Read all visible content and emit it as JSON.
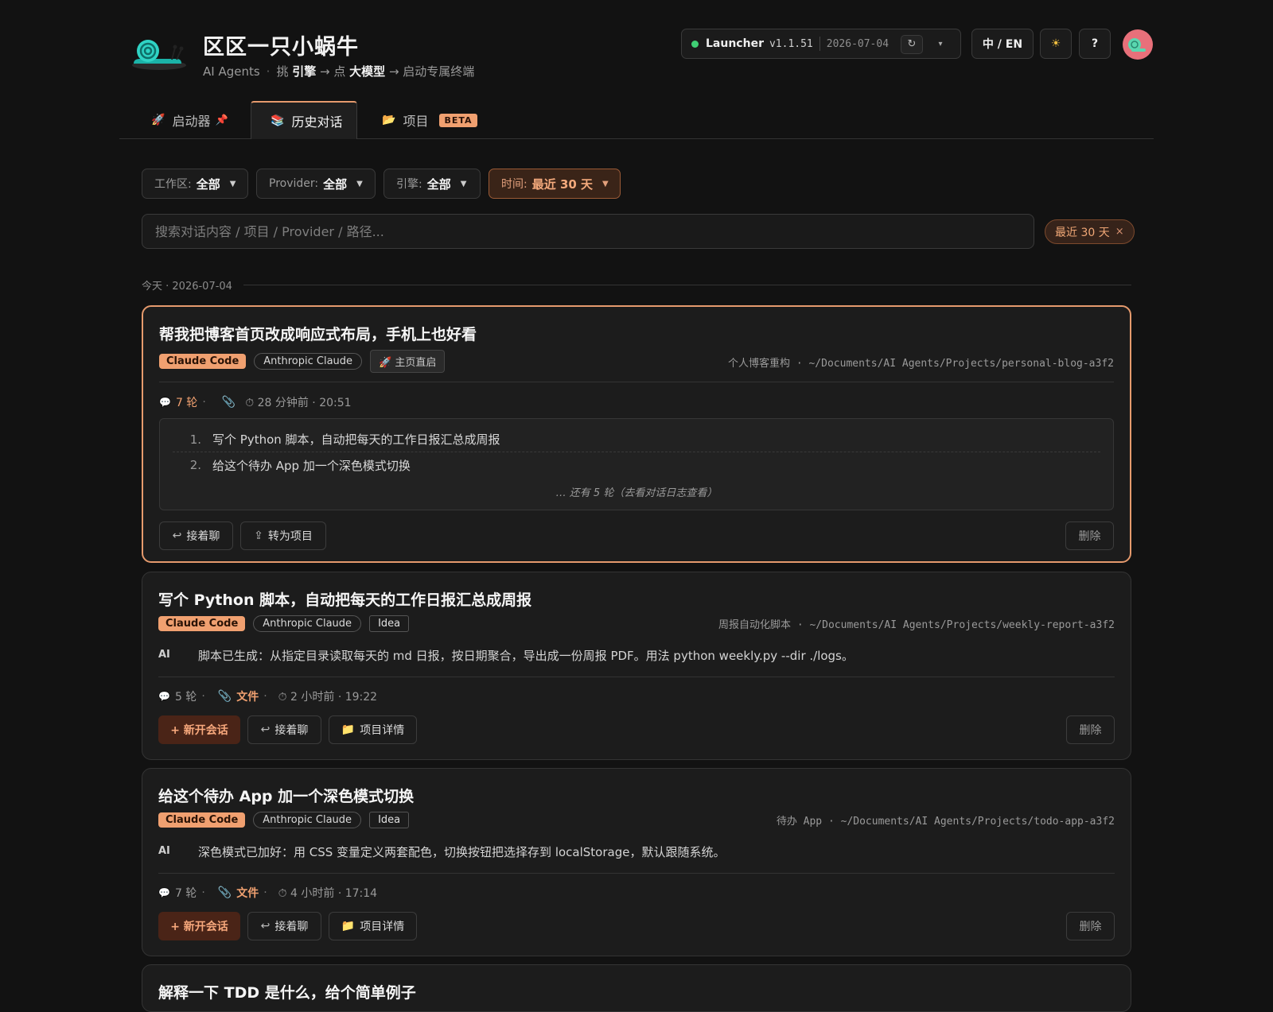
{
  "brand": {
    "title": "区区一只小蜗牛",
    "sub_prefix": "AI Agents",
    "sub_sep": "·",
    "sub_pick": "挑",
    "sub_engine": "引擎",
    "sub_arrow1": "→ 点",
    "sub_model": "大模型",
    "sub_arrow2": "→ 启动专属终端"
  },
  "launcher": {
    "name": "Launcher",
    "version": "v1.1.51",
    "date": "2026-07-04",
    "refresh_icon": "↻",
    "caret_icon": "▾",
    "status_color": "#3fcf74"
  },
  "header_buttons": {
    "lang": "中 / EN",
    "theme_icon": "☀",
    "help": "?"
  },
  "tabs": [
    {
      "icon": "🚀",
      "label": "启动器",
      "pin": "📌"
    },
    {
      "icon": "📚",
      "label": "历史对话"
    },
    {
      "icon": "📂",
      "label": "项目",
      "badge": "BETA"
    }
  ],
  "filters": {
    "workspace": {
      "label": "工作区:",
      "value": "全部"
    },
    "provider": {
      "label": "Provider:",
      "value": "全部"
    },
    "engine": {
      "label": "引擎:",
      "value": "全部"
    },
    "time": {
      "label": "时间:",
      "value": "最近 30 天"
    },
    "arrow": "▼"
  },
  "search": {
    "placeholder": "搜索对话内容 / 项目 / Provider / 路径..."
  },
  "active_chip": {
    "label": "最近 30 天",
    "close": "×"
  },
  "day_label": "今天 · 2026-07-04",
  "cards": [
    {
      "title": "帮我把博客首页改成响应式布局，手机上也好看",
      "engine": "Claude Code",
      "provider": "Anthropic Claude",
      "tag": "🚀 主页直启",
      "project": "个人博客重构 · ~/Documents/AI Agents/Projects/personal-blog-a3f2",
      "turns": "7 轮",
      "time": "⏱ 28 分钟前 · 20:51",
      "history": [
        "写个 Python 脚本，自动把每天的工作日报汇总成周报",
        "给这个待办 App 加一个深色模式切换"
      ],
      "history_nums": [
        "1.",
        "2."
      ],
      "more": "… 还有 5 轮（去看对话日志查看）",
      "btn_resume": "接着聊",
      "btn_convert": "转为项目",
      "btn_delete": "删除"
    },
    {
      "title": "写个 Python 脚本，自动把每天的工作日报汇总成周报",
      "engine": "Claude Code",
      "provider": "Anthropic Claude",
      "tag": "Idea",
      "project": "周报自动化脚本 · ~/Documents/AI Agents/Projects/weekly-report-a3f2",
      "ai_label": "AI",
      "ai_text": "脚本已生成：从指定目录读取每天的 md 日报，按日期聚合，导出成一份周报 PDF。用法 python weekly.py --dir ./logs。",
      "turns": "5 轮",
      "files": "文件",
      "time": "⏱ 2 小时前 · 19:22",
      "btn_new": "+ 新开会话",
      "btn_resume": "接着聊",
      "btn_detail": "项目详情",
      "btn_delete": "删除"
    },
    {
      "title": "给这个待办 App 加一个深色模式切换",
      "engine": "Claude Code",
      "provider": "Anthropic Claude",
      "tag": "Idea",
      "project": "待办 App · ~/Documents/AI Agents/Projects/todo-app-a3f2",
      "ai_label": "AI",
      "ai_text": "深色模式已加好：用 CSS 变量定义两套配色，切换按钮把选择存到 localStorage，默认跟随系统。",
      "turns": "7 轮",
      "files": "文件",
      "time": "⏱ 4 小时前 · 17:14",
      "btn_new": "+ 新开会话",
      "btn_resume": "接着聊",
      "btn_detail": "项目详情",
      "btn_delete": "删除"
    },
    {
      "title": "解释一下 TDD 是什么，给个简单例子"
    }
  ],
  "icons": {
    "chat": "💬",
    "clip": "📎",
    "resume": "↩",
    "convert": "⇪",
    "folder": "📁",
    "dot": "·"
  },
  "accent_color": "#f0a070"
}
